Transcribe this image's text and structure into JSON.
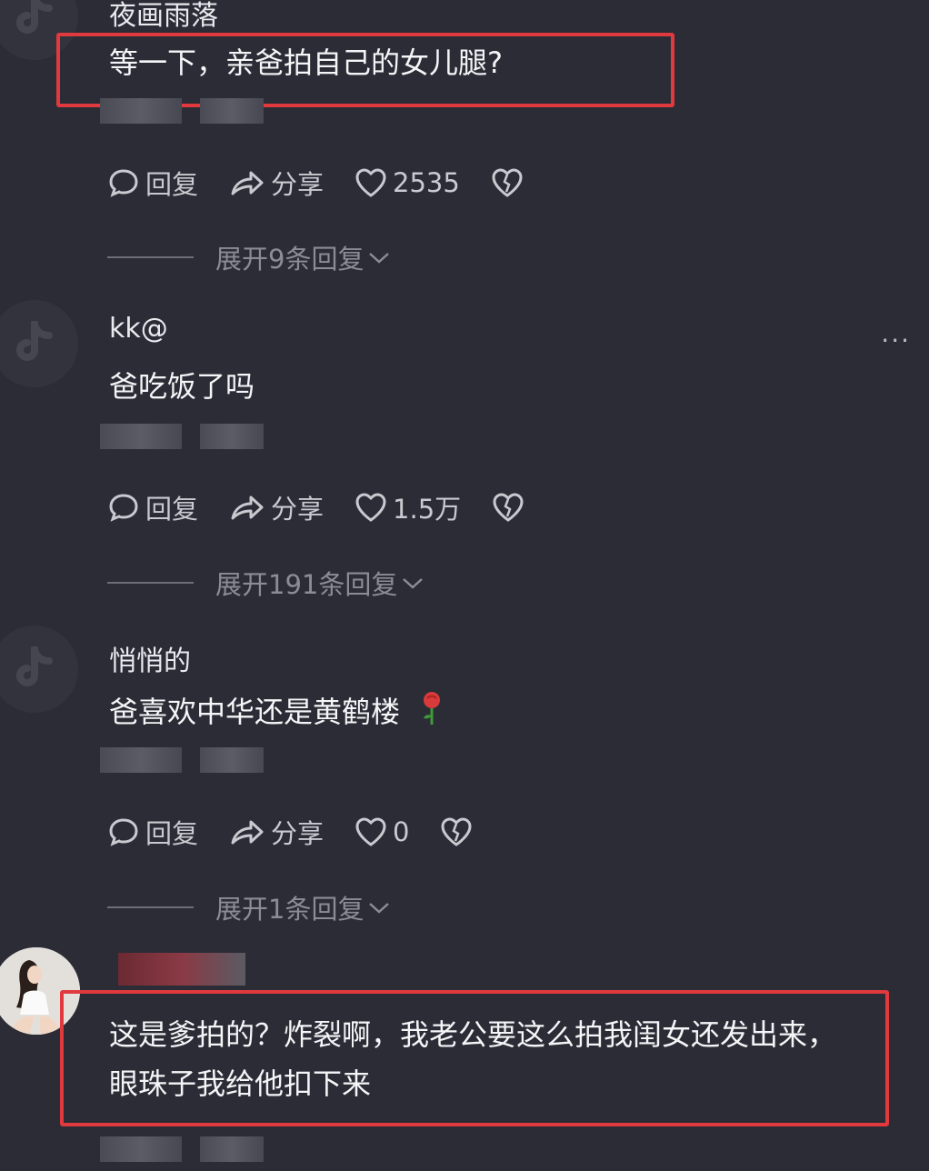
{
  "comments": [
    {
      "username": "夜画雨落",
      "text": "等一下，亲爸拍自己的女儿腿?",
      "reply_label": "回复",
      "share_label": "分享",
      "likes": "2535",
      "expand_label": "展开9条回复"
    },
    {
      "username": "kk@",
      "text": "爸吃饭了吗",
      "reply_label": "回复",
      "share_label": "分享",
      "likes": "1.5万",
      "expand_label": "展开191条回复"
    },
    {
      "username": "悄悄的",
      "text": "爸喜欢中华还是黄鹤楼",
      "reply_label": "回复",
      "share_label": "分享",
      "likes": "0",
      "expand_label": "展开1条回复"
    },
    {
      "username": "",
      "text_line1": "这是爹拍的？炸裂啊，我老公要这么拍我闺女还发出来，",
      "text_line2": "眼珠子我给他扣下来"
    }
  ],
  "more_label": "···",
  "colors": {
    "background": "#2b2c36",
    "highlight": "#e0393e",
    "muted": "#8b8c95"
  },
  "icons": [
    "tiktok-avatar-icon",
    "comment-icon",
    "share-icon",
    "heart-icon",
    "dislike-heart-icon",
    "chevron-down-icon",
    "rose-emoji-icon"
  ]
}
